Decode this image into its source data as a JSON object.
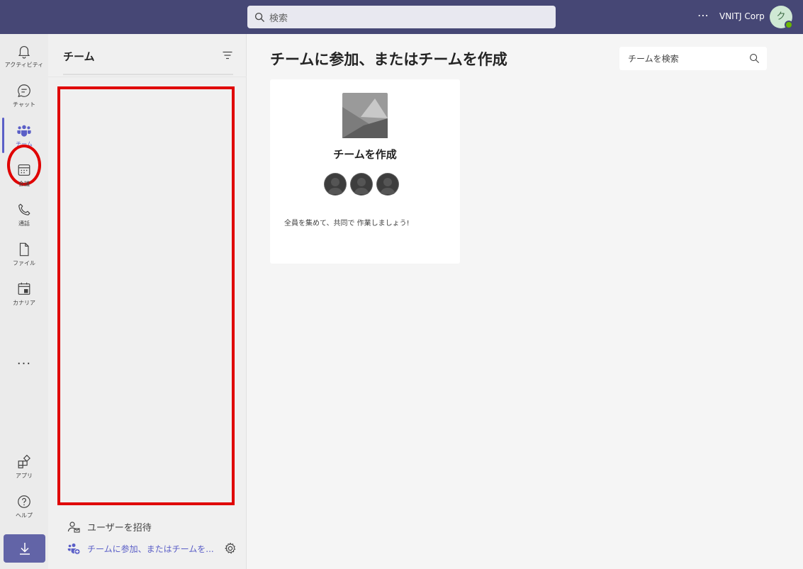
{
  "topbar": {
    "search_placeholder": "検索",
    "more": "⋯",
    "org": "VNITJ Corp",
    "avatar_initial": "ク"
  },
  "rail": {
    "items": [
      {
        "label": "アクティビティ",
        "icon": "bell-icon"
      },
      {
        "label": "チャット",
        "icon": "chat-icon"
      },
      {
        "label": "チーム",
        "icon": "teams-icon",
        "active": true
      },
      {
        "label": "会議",
        "icon": "calendar-icon"
      },
      {
        "label": "通話",
        "icon": "phone-icon"
      },
      {
        "label": "ファイル",
        "icon": "file-icon"
      },
      {
        "label": "カナリア",
        "icon": "canary-icon"
      }
    ],
    "more": "···",
    "apps_label": "アプリ",
    "help_label": "ヘルプ"
  },
  "panel": {
    "title": "チーム",
    "invite_label": "ユーザーを招待",
    "join_label": "チームに参加、またはチームを..."
  },
  "main": {
    "title": "チームに参加、またはチームを作成",
    "search_placeholder": "チームを検索",
    "card": {
      "title": "チームを作成",
      "description": "全員を集めて、共同で 作業しましょう!"
    }
  },
  "colors": {
    "topbar": "#464775",
    "accent": "#5b5fc7",
    "annotation_red": "#e00000"
  }
}
